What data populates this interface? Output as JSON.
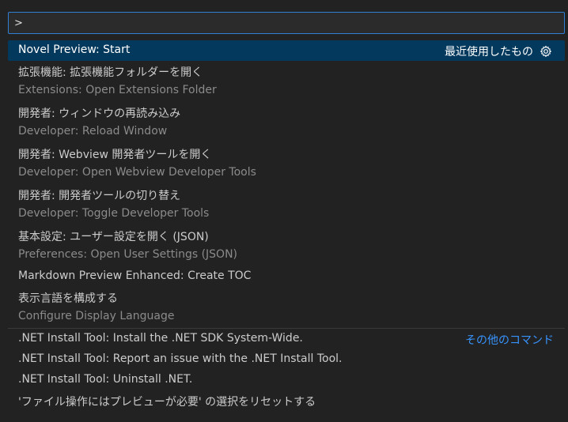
{
  "quick_open": {
    "input_value": ">",
    "items": [
      {
        "label": "Novel Preview: Start",
        "right_label": "最近使用したもの",
        "gear_icon": "gear-icon",
        "selected": true
      },
      {
        "label": "拡張機能: 拡張機能フォルダーを開く",
        "detail": "Extensions: Open Extensions Folder"
      },
      {
        "label": "開発者: ウィンドウの再読み込み",
        "detail": "Developer: Reload Window"
      },
      {
        "label": "開発者: Webview 開発者ツールを開く",
        "detail": "Developer: Open Webview Developer Tools"
      },
      {
        "label": "開発者: 開発者ツールの切り替え",
        "detail": "Developer: Toggle Developer Tools"
      },
      {
        "label": "基本設定: ユーザー設定を開く (JSON)",
        "detail": "Preferences: Open User Settings (JSON)"
      },
      {
        "label": "Markdown Preview Enhanced: Create TOC"
      },
      {
        "label": "表示言語を構成する",
        "detail": "Configure Display Language"
      },
      {
        "label": ".NET Install Tool: Install the .NET SDK System-Wide.",
        "right_link": "その他のコマンド"
      },
      {
        "label": ".NET Install Tool: Report an issue with the .NET Install Tool."
      },
      {
        "label": ".NET Install Tool: Uninstall .NET."
      },
      {
        "label": "'ファイル操作にはプレビューが必要' の選択をリセットする"
      }
    ]
  },
  "colors": {
    "background": "#222222",
    "input_border": "#2f7fd3",
    "selected_row": "#04395e",
    "link": "#3794ff",
    "detail_text": "#8b8b8b"
  }
}
